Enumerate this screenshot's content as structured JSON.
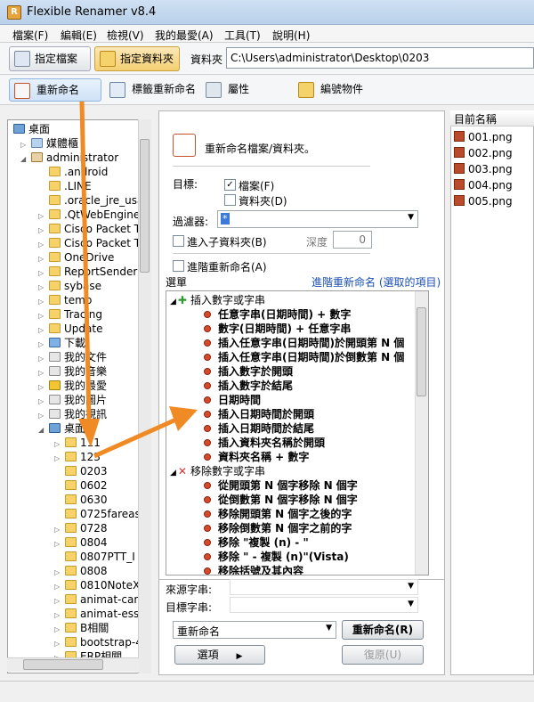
{
  "window": {
    "title": "Flexible Renamer v8.4",
    "app_icon_text": "R"
  },
  "menu": [
    "檔案(F)",
    "編輯(E)",
    "檢視(V)",
    "我的最愛(A)",
    "工具(T)",
    "說明(H)"
  ],
  "toolbar": {
    "specify_file": "指定檔案",
    "specify_folder": "指定資料夾",
    "path_label": "資料夾",
    "path_value": "C:\\Users\\administrator\\Desktop\\0203"
  },
  "tabs": [
    "重新命名",
    "標籤重新命名",
    "屬性",
    "編號物件"
  ],
  "tree": {
    "root": "桌面",
    "items": [
      {
        "label": "媒體櫃"
      },
      {
        "label": "administrator"
      },
      {
        "label": ".android"
      },
      {
        "label": ".LINE"
      },
      {
        "label": ".oracle_jre_usa"
      },
      {
        "label": ".QtWebEngine"
      },
      {
        "label": "Cisco Packet T"
      },
      {
        "label": "Cisco Packet T"
      },
      {
        "label": "OneDrive"
      },
      {
        "label": "ReportSender"
      },
      {
        "label": "sybase"
      },
      {
        "label": "temp"
      },
      {
        "label": "Tracing"
      },
      {
        "label": "Update"
      },
      {
        "label": "下載"
      },
      {
        "label": "我的文件"
      },
      {
        "label": "我的音樂"
      },
      {
        "label": "我的最愛"
      },
      {
        "label": "我的圖片"
      },
      {
        "label": "我的視訊"
      },
      {
        "label": "桌面"
      },
      {
        "label": "111"
      },
      {
        "label": "123"
      },
      {
        "label": "0203"
      },
      {
        "label": "0602"
      },
      {
        "label": "0630"
      },
      {
        "label": "0725fareas"
      },
      {
        "label": "0728"
      },
      {
        "label": "0804"
      },
      {
        "label": "0807PTT_I"
      },
      {
        "label": "0808"
      },
      {
        "label": "0810NoteX"
      },
      {
        "label": "animat-cam"
      },
      {
        "label": "animat-esse"
      },
      {
        "label": "B相關"
      },
      {
        "label": "bootstrap-4"
      },
      {
        "label": "ERP相關"
      }
    ]
  },
  "panel": {
    "header": "重新命名檔案/資料夾。",
    "target_label": "目標:",
    "files": "檔案(F)",
    "folders": "資料夾(D)",
    "filter_label": "過濾器:",
    "filter_value": "*",
    "subfolders": "進入子資料夾(B)",
    "depth_label": "深度",
    "depth_value": "0",
    "advanced": "進階重新命名(A)",
    "options_label": "選單",
    "advanced_link": "進階重新命名 (選取的項目)",
    "source_label": "來源字串:",
    "target_str_label": "目標字串:",
    "mode_value": "重新命名",
    "rename_btn": "重新命名(R)",
    "options_btn": "選項",
    "restore_btn": "復原(U)"
  },
  "operations": {
    "group1": "插入數字或字串",
    "group1_items": [
      "任意字串(日期時間) + 數字",
      "數字(日期時間) + 任意字串",
      "插入任意字串(日期時間)於開頭第 N 個",
      "插入任意字串(日期時間)於倒數第 N 個",
      "插入數字於開頭",
      "插入數字於結尾",
      "日期時間",
      "插入日期時間於開頭",
      "插入日期時間於結尾",
      "插入資料夾名稱於開頭",
      "資料夾名稱 + 數字"
    ],
    "group2": "移除數字或字串",
    "group2_items": [
      "從開頭第 N 個字移除 N 個字",
      "從倒數第 N 個字移除 N 個字",
      "移除開頭第 N 個字之後的字",
      "移除倒數第 N 個字之前的字",
      "移除 \"複製 (n) - \"",
      "移除 \" - 複製 (n)\"(Vista)",
      "移除括號及其內容"
    ]
  },
  "files_panel": {
    "header": "目前名稱",
    "files": [
      "001.png",
      "002.png",
      "003.png",
      "004.png",
      "005.png"
    ]
  },
  "colors": {
    "accent_orange": "#f08a24",
    "title_blue": "#b9d1ea",
    "link_blue": "#1a4fb5"
  }
}
